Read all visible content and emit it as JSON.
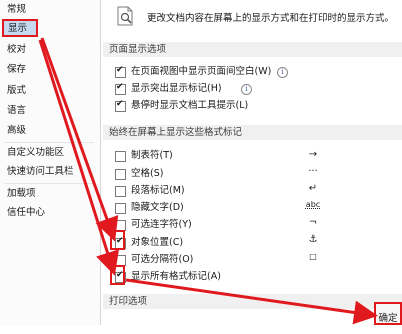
{
  "sidebar": {
    "items": [
      {
        "label": "常规"
      },
      {
        "label": "显示"
      },
      {
        "label": "校对"
      },
      {
        "label": "保存"
      },
      {
        "label": "版式"
      },
      {
        "label": "语言"
      },
      {
        "label": "高级"
      },
      {
        "label": "自定义功能区"
      },
      {
        "label": "快速访问工具栏"
      },
      {
        "label": "加载项"
      },
      {
        "label": "信任中心"
      }
    ]
  },
  "main": {
    "description": "更改文档内容在屏幕上的显示方式和在打印时的显示方式。",
    "page_display_section": {
      "title": "页面显示选项",
      "options": [
        {
          "label": "在页面视图中显示页面间空白(W)",
          "checked": true,
          "has_info": true
        },
        {
          "label": "显示突出显示标记(H)",
          "checked": true,
          "has_info": true
        },
        {
          "label": "悬停时显示文档工具提示(L)",
          "checked": true,
          "has_info": false
        }
      ]
    },
    "format_marks_section": {
      "title": "始终在屏幕上显示这些格式标记",
      "options": [
        {
          "label": "制表符(T)",
          "checked": false,
          "symbol": "→"
        },
        {
          "label": "空格(S)",
          "checked": false,
          "symbol": "···"
        },
        {
          "label": "段落标记(M)",
          "checked": false,
          "symbol": "↵"
        },
        {
          "label": "隐藏文字(D)",
          "checked": false,
          "symbol": "abc"
        },
        {
          "label": "可选连字符(Y)",
          "checked": false,
          "symbol": "¬"
        },
        {
          "label": "对象位置(C)",
          "checked": true,
          "symbol": "⚓"
        },
        {
          "label": "可选分隔符(O)",
          "checked": false,
          "symbol": "□"
        },
        {
          "label": "显示所有格式标记(A)",
          "checked": true,
          "symbol": ""
        }
      ]
    },
    "print_section": {
      "title": "打印选项"
    }
  },
  "footer": {
    "ok_label": "确定"
  },
  "colors": {
    "highlight_red": "#e0191f",
    "selected_bg": "#c5d9ef"
  }
}
